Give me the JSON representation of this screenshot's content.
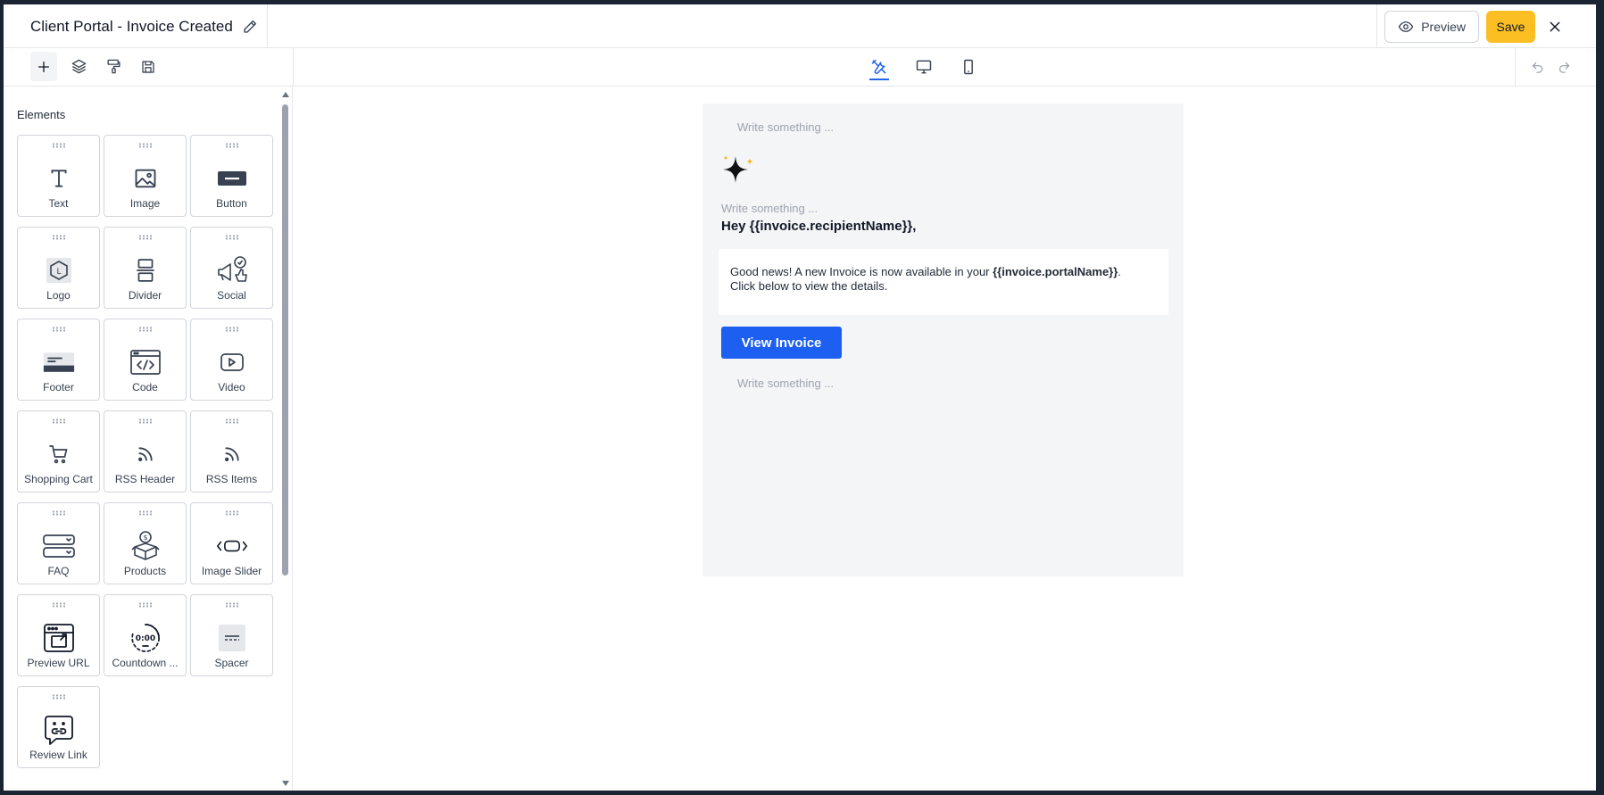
{
  "header": {
    "title": "Client Portal - Invoice Created",
    "preview_label": "Preview",
    "save_label": "Save"
  },
  "toolbar": {
    "left_tools": [
      "add-icon",
      "layers-icon",
      "paint-roller-icon",
      "save-disk-icon"
    ],
    "view_tabs": [
      "tools-icon",
      "desktop-icon",
      "mobile-icon"
    ],
    "history": [
      "undo-icon",
      "redo-icon"
    ]
  },
  "sidebar": {
    "title": "Elements",
    "elements": [
      {
        "label": "Text",
        "icon": "text-icon"
      },
      {
        "label": "Image",
        "icon": "image-icon"
      },
      {
        "label": "Button",
        "icon": "button-icon"
      },
      {
        "label": "Logo",
        "icon": "logo-icon"
      },
      {
        "label": "Divider",
        "icon": "divider-icon"
      },
      {
        "label": "Social",
        "icon": "social-icon"
      },
      {
        "label": "Footer",
        "icon": "footer-icon"
      },
      {
        "label": "Code",
        "icon": "code-icon"
      },
      {
        "label": "Video",
        "icon": "video-icon"
      },
      {
        "label": "Shopping Cart",
        "icon": "cart-icon"
      },
      {
        "label": "RSS Header",
        "icon": "rss-icon"
      },
      {
        "label": "RSS Items",
        "icon": "rss-icon"
      },
      {
        "label": "FAQ",
        "icon": "faq-icon"
      },
      {
        "label": "Products",
        "icon": "products-icon"
      },
      {
        "label": "Image Slider",
        "icon": "slider-icon"
      },
      {
        "label": "Preview URL",
        "icon": "preview-url-icon"
      },
      {
        "label": "Countdown ...",
        "icon": "countdown-icon"
      },
      {
        "label": "Spacer",
        "icon": "spacer-icon"
      },
      {
        "label": "Review Link",
        "icon": "review-link-icon"
      }
    ]
  },
  "email": {
    "placeholder_top": "Write something ...",
    "placeholder_mid": "Write something ...",
    "greeting": "Hey {{invoice.recipientName}},",
    "body_prefix": "Good news! A new Invoice is now available in your ",
    "body_variable": "{{invoice.portalName}}",
    "body_suffix": ".",
    "body_line2": "Click below to view the details.",
    "button_label": "View Invoice",
    "placeholder_bottom": "Write something ...",
    "accent_color": "#1d5ff0"
  },
  "colors": {
    "save": "#fbbf24",
    "active_tab": "#2563eb",
    "canvas_bg": "#f4f5f7"
  }
}
